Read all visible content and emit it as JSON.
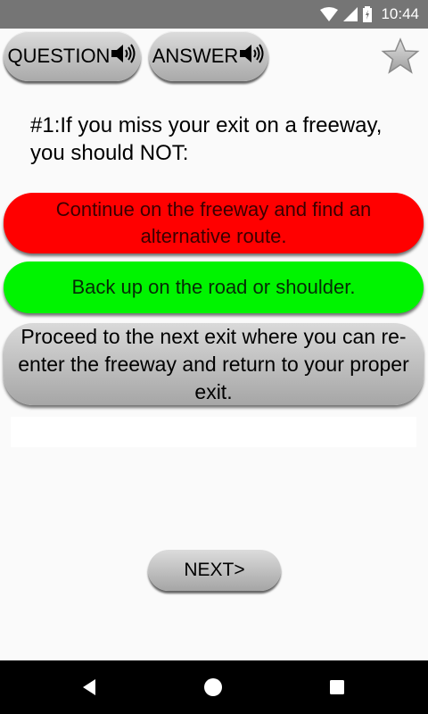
{
  "status_bar": {
    "time": "10:44"
  },
  "header": {
    "question_label": "QUESTION",
    "answer_label": "ANSWER"
  },
  "question": {
    "text": "#1:If you miss your exit on a freeway, you should NOT:"
  },
  "options": [
    {
      "text": "Continue on the freeway and find an alternative route.",
      "color": "#ff0000",
      "state": "incorrect"
    },
    {
      "text": "Back up on the road or shoulder.",
      "color": "#00f400",
      "state": "correct"
    },
    {
      "text": "Proceed to the next exit where you can re-enter the freeway and return to your proper exit.",
      "color": "#bdbdbd",
      "state": "neutral"
    }
  ],
  "footer": {
    "next_label": "NEXT>"
  },
  "icons": {
    "speaker": "speaker-icon",
    "favorite": "star-icon",
    "nav": [
      "back-icon",
      "home-icon",
      "recents-icon"
    ]
  }
}
